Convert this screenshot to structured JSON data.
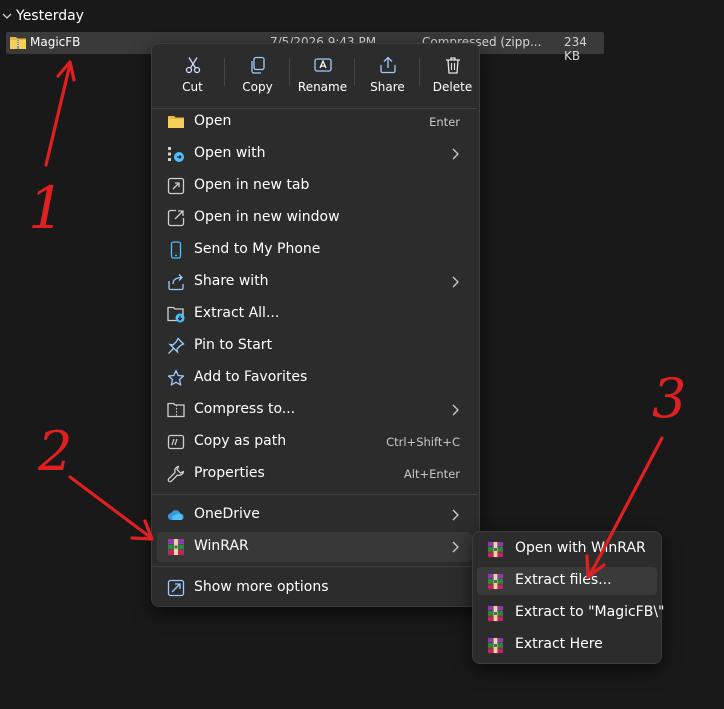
{
  "group": {
    "label": "Yesterday"
  },
  "file": {
    "name": "MagicFB",
    "date": "7/5/2026 9:43 PM",
    "type": "Compressed (zipp...",
    "size": "234 KB"
  },
  "quickbar": [
    {
      "label": "Cut",
      "icon": "scissors-icon"
    },
    {
      "label": "Copy",
      "icon": "copy-icon"
    },
    {
      "label": "Rename",
      "icon": "rename-icon"
    },
    {
      "label": "Share",
      "icon": "share-icon"
    },
    {
      "label": "Delete",
      "icon": "trash-icon"
    }
  ],
  "menu": {
    "open": {
      "label": "Open",
      "shortcut": "Enter"
    },
    "open_with": {
      "label": "Open with"
    },
    "open_new_tab": {
      "label": "Open in new tab"
    },
    "open_new_window": {
      "label": "Open in new window"
    },
    "send_to_phone": {
      "label": "Send to My Phone"
    },
    "share_with": {
      "label": "Share with"
    },
    "extract_all": {
      "label": "Extract All..."
    },
    "pin_to_start": {
      "label": "Pin to Start"
    },
    "add_to_favorites": {
      "label": "Add to Favorites"
    },
    "compress_to": {
      "label": "Compress to..."
    },
    "copy_as_path": {
      "label": "Copy as path",
      "shortcut": "Ctrl+Shift+C"
    },
    "properties": {
      "label": "Properties",
      "shortcut": "Alt+Enter"
    },
    "onedrive": {
      "label": "OneDrive"
    },
    "winrar": {
      "label": "WinRAR"
    },
    "show_more": {
      "label": "Show more options"
    }
  },
  "submenu": [
    {
      "label": "Open with WinRAR"
    },
    {
      "label": "Extract files..."
    },
    {
      "label": "Extract to \"MagicFB\\\""
    },
    {
      "label": "Extract Here"
    }
  ],
  "annotations": {
    "one": "1",
    "two": "2",
    "three": "3",
    "color": "#e02020"
  },
  "colors": {
    "background": "#191919",
    "menu": "#2c2c2c",
    "highlight": "#383838",
    "accent": "#4cc2ff"
  }
}
